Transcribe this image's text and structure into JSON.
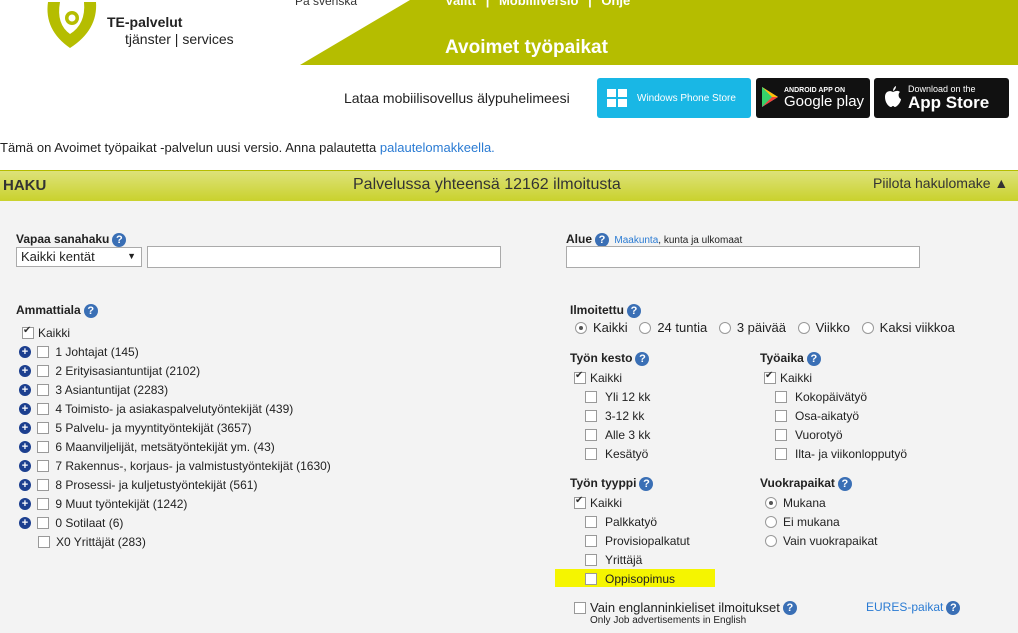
{
  "header": {
    "logo_line1": "TE-palvelut",
    "logo_line2": "tjänster | services",
    "lang_link": "På svenska",
    "top_links": [
      "Valitt",
      "|",
      "Mobiiliversio",
      "|",
      "Ohje"
    ],
    "service_title": "Avoimet työpaikat",
    "mobile_text": "Lataa mobiilisovellus älypuhelimeesi",
    "store_windows": "Windows Phone Store",
    "store_google_top": "ANDROID APP ON",
    "store_google": "Google play",
    "store_apple_top": "Download on the",
    "store_apple": "App Store",
    "brand_color": "#b5bd00"
  },
  "notice": {
    "text": "Tämä on Avoimet työpaikat -palvelun uusi versio. Anna palautetta ",
    "link": "palautelomakkeella."
  },
  "haku": {
    "title": "HAKU",
    "count": "Palvelussa yhteensä 12162 ilmoitusta",
    "toggle": "Piilota hakulomake ▲"
  },
  "search": {
    "label": "Vapaa sanahaku",
    "select_value": "Kaikki kentät",
    "value": ""
  },
  "area": {
    "label": "Alue",
    "link": "Maakunta",
    "suffix": ", kunta ja ulkomaat",
    "value": ""
  },
  "occupation": {
    "label": "Ammattiala",
    "all": "Kaikki",
    "items": [
      "1 Johtajat (145)",
      "2 Erityisasiantuntijat (2102)",
      "3 Asiantuntijat (2283)",
      "4 Toimisto- ja asiakaspalvelutyöntekijät (439)",
      "5 Palvelu- ja myyntityöntekijät (3657)",
      "6 Maanviljelijät, metsätyöntekijät ym. (43)",
      "7 Rakennus-, korjaus- ja valmistustyöntekijät (1630)",
      "8 Prosessi- ja kuljetustyöntekijät (561)",
      "9 Muut työntekijät (1242)",
      "0 Sotilaat (6)",
      "X0 Yrittäjät (283)"
    ]
  },
  "published": {
    "label": "Ilmoitettu",
    "options": [
      "Kaikki",
      "24 tuntia",
      "3 päivää",
      "Viikko",
      "Kaksi viikkoa"
    ]
  },
  "duration": {
    "label": "Työn kesto",
    "all": "Kaikki",
    "items": [
      "Yli 12 kk",
      "3-12 kk",
      "Alle 3 kk",
      "Kesätyö"
    ]
  },
  "worktime": {
    "label": "Työaika",
    "all": "Kaikki",
    "items": [
      "Kokopäivätyö",
      "Osa-aikatyö",
      "Vuorotyö",
      "Ilta- ja viikonlopputyö"
    ]
  },
  "jobtype": {
    "label": "Työn tyyppi",
    "all": "Kaikki",
    "items": [
      "Palkkatyö",
      "Provisiopalkatut",
      "Yrittäjä",
      "Oppisopimus"
    ]
  },
  "rental": {
    "label": "Vuokrapaikat",
    "options": [
      "Mukana",
      "Ei mukana",
      "Vain vuokrapaikat"
    ]
  },
  "english": {
    "label": "Vain englanninkieliset ilmoitukset",
    "sub": "Only Job advertisements in English"
  },
  "eures": {
    "label": "EURES-paikat"
  },
  "help_glyph": "?"
}
